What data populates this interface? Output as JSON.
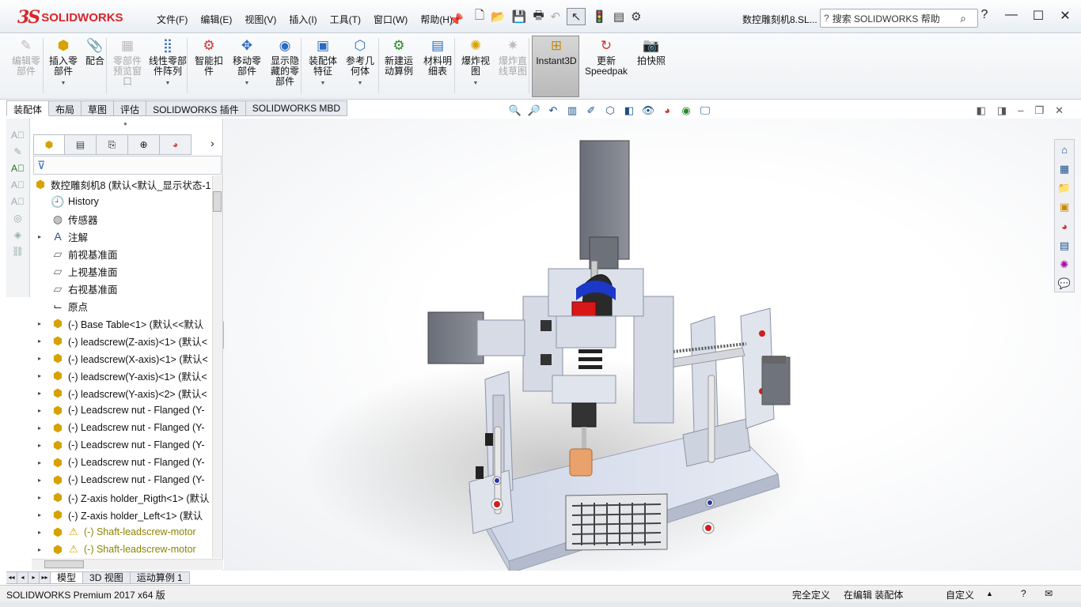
{
  "app": {
    "logo_ds": "3S",
    "logo_text": "SOLIDWORKS",
    "doc_title": "数控雕刻机8.SL...",
    "search_placeholder": "搜索 SOLIDWORKS 帮助"
  },
  "menu": [
    "文件(F)",
    "编辑(E)",
    "视图(V)",
    "插入(I)",
    "工具(T)",
    "窗口(W)",
    "帮助(H)"
  ],
  "ribbon": [
    {
      "label": "编辑零部件",
      "disabled": true
    },
    {
      "label": "插入零部件",
      "disabled": false
    },
    {
      "label": "配合",
      "disabled": false
    },
    {
      "label": "零部件预览窗口",
      "disabled": true
    },
    {
      "label": "线性零部件阵列",
      "disabled": false
    },
    {
      "label": "智能扣件",
      "disabled": false
    },
    {
      "label": "移动零部件",
      "disabled": false
    },
    {
      "label": "显示隐藏的零部件",
      "disabled": false
    },
    {
      "label": "装配体特征",
      "disabled": false
    },
    {
      "label": "参考几何体",
      "disabled": false
    },
    {
      "label": "新建运动算例",
      "disabled": false
    },
    {
      "label": "材料明细表",
      "disabled": false
    },
    {
      "label": "爆炸视图",
      "disabled": false
    },
    {
      "label": "爆炸直线草图",
      "disabled": true
    },
    {
      "label": "Instant3D",
      "disabled": false
    },
    {
      "label": "更新Speedpak",
      "disabled": false
    },
    {
      "label": "拍快照",
      "disabled": false
    }
  ],
  "command_tabs": [
    "装配体",
    "布局",
    "草图",
    "评估",
    "SOLIDWORKS 插件",
    "SOLIDWORKS MBD"
  ],
  "tree": {
    "root": "数控雕刻机8  (默认<默认_显示状态-1",
    "items": [
      {
        "label": "History",
        "type": "history"
      },
      {
        "label": "传感器",
        "type": "sensor"
      },
      {
        "label": "注解",
        "type": "annotation",
        "expand": true
      },
      {
        "label": "前视基准面",
        "type": "plane"
      },
      {
        "label": "上视基准面",
        "type": "plane"
      },
      {
        "label": "右视基准面",
        "type": "plane"
      },
      {
        "label": "原点",
        "type": "origin"
      },
      {
        "label": "(-) Base Table<1>  (默认<<默认",
        "type": "part",
        "expand": true
      },
      {
        "label": "(-) leadscrew(Z-axis)<1>  (默认<",
        "type": "part",
        "expand": true
      },
      {
        "label": "(-) leadscrew(X-axis)<1>  (默认<",
        "type": "part",
        "expand": true
      },
      {
        "label": "(-) leadscrew(Y-axis)<1>  (默认<",
        "type": "part",
        "expand": true
      },
      {
        "label": "(-) leadscrew(Y-axis)<2>  (默认<",
        "type": "part",
        "expand": true
      },
      {
        "label": "(-) Leadscrew nut - Flanged (Y-",
        "type": "part",
        "expand": true
      },
      {
        "label": "(-) Leadscrew nut - Flanged (Y-",
        "type": "part",
        "expand": true
      },
      {
        "label": "(-) Leadscrew nut - Flanged (Y-",
        "type": "part",
        "expand": true
      },
      {
        "label": "(-) Leadscrew nut - Flanged (Y-",
        "type": "part",
        "expand": true
      },
      {
        "label": "(-) Leadscrew nut - Flanged (Y-",
        "type": "part",
        "expand": true
      },
      {
        "label": "(-) Z-axis holder_Rigth<1>  (默认",
        "type": "part",
        "expand": true
      },
      {
        "label": "(-) Z-axis holder_Left<1>  (默认",
        "type": "part",
        "expand": true
      },
      {
        "label": "(-) Shaft-leadscrew-motor",
        "type": "warn",
        "expand": true
      },
      {
        "label": "(-) Shaft-leadscrew-motor",
        "type": "warn",
        "expand": true
      }
    ]
  },
  "bottom_tabs": [
    "模型",
    "3D 视图",
    "运动算例 1"
  ],
  "status": {
    "product": "SOLIDWORKS Premium 2017 x64 版",
    "defined": "完全定义",
    "editing": "在编辑 装配体",
    "custom": "自定义"
  }
}
